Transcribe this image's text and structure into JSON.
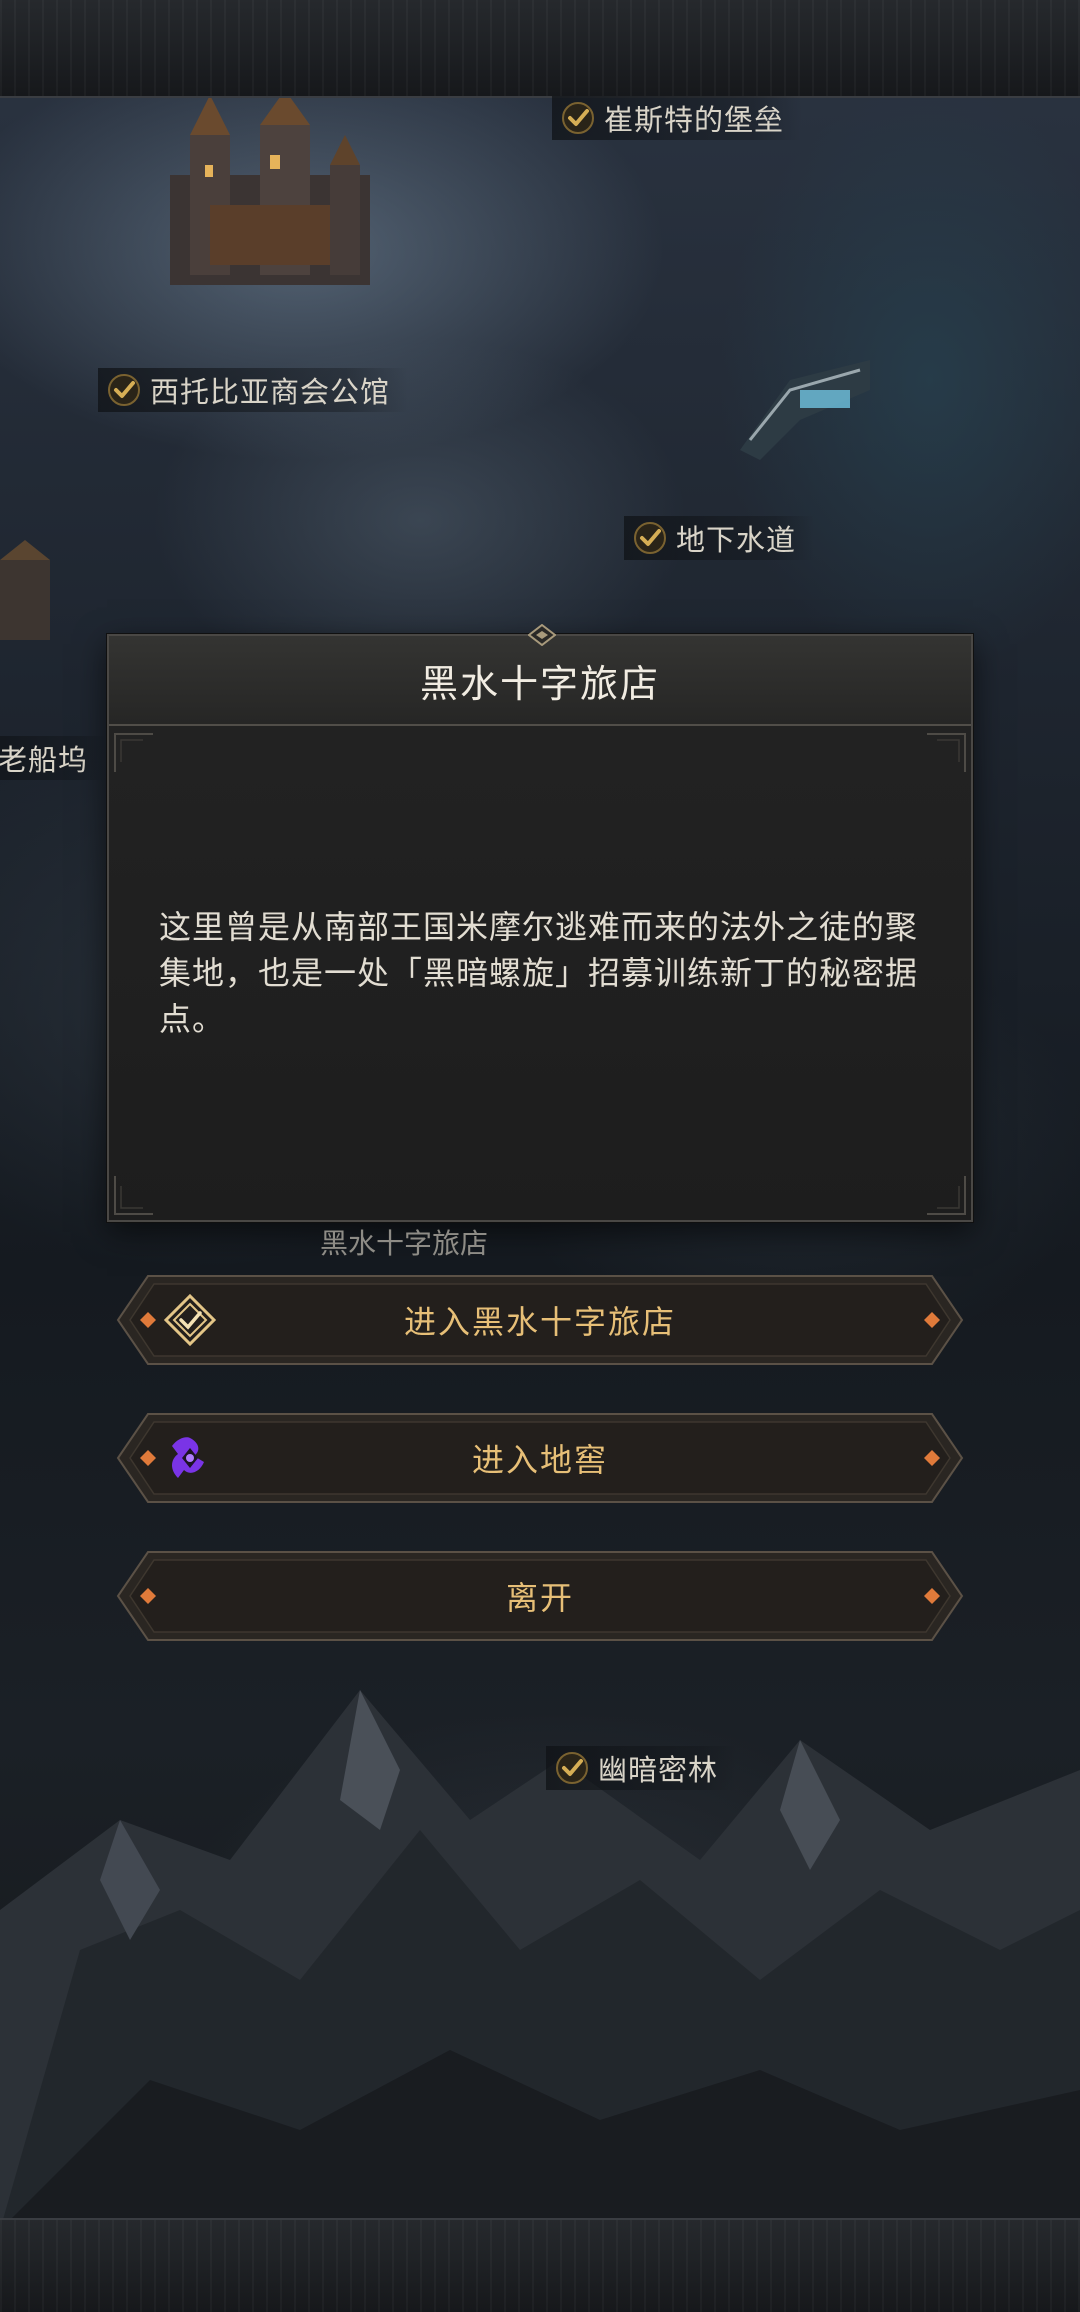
{
  "map": {
    "locations": [
      {
        "label": "崔斯特的堡垒"
      },
      {
        "label": "西托比亚商会公馆"
      },
      {
        "label": "地下水道"
      },
      {
        "label": "老船坞"
      },
      {
        "label": "幽暗密林"
      }
    ],
    "selected_location_label": "黑水十字旅店"
  },
  "dialog": {
    "title": "黑水十字旅店",
    "description": "这里曾是从南部王国米摩尔逃难而来的法外之徒的聚集地，也是一处「黑暗螺旋」招募训练新丁的秘密据点。"
  },
  "actions": [
    {
      "label": "进入黑水十字旅店",
      "icon": "inn-emblem-icon"
    },
    {
      "label": "进入地窖",
      "icon": "purple-spiral-icon"
    },
    {
      "label": "离开"
    }
  ],
  "colors": {
    "button_text": "#e7bf77",
    "check_gold": "#c9a24a",
    "spiral_purple": "#8a3cf0",
    "gem_orange": "#e07a3a"
  }
}
